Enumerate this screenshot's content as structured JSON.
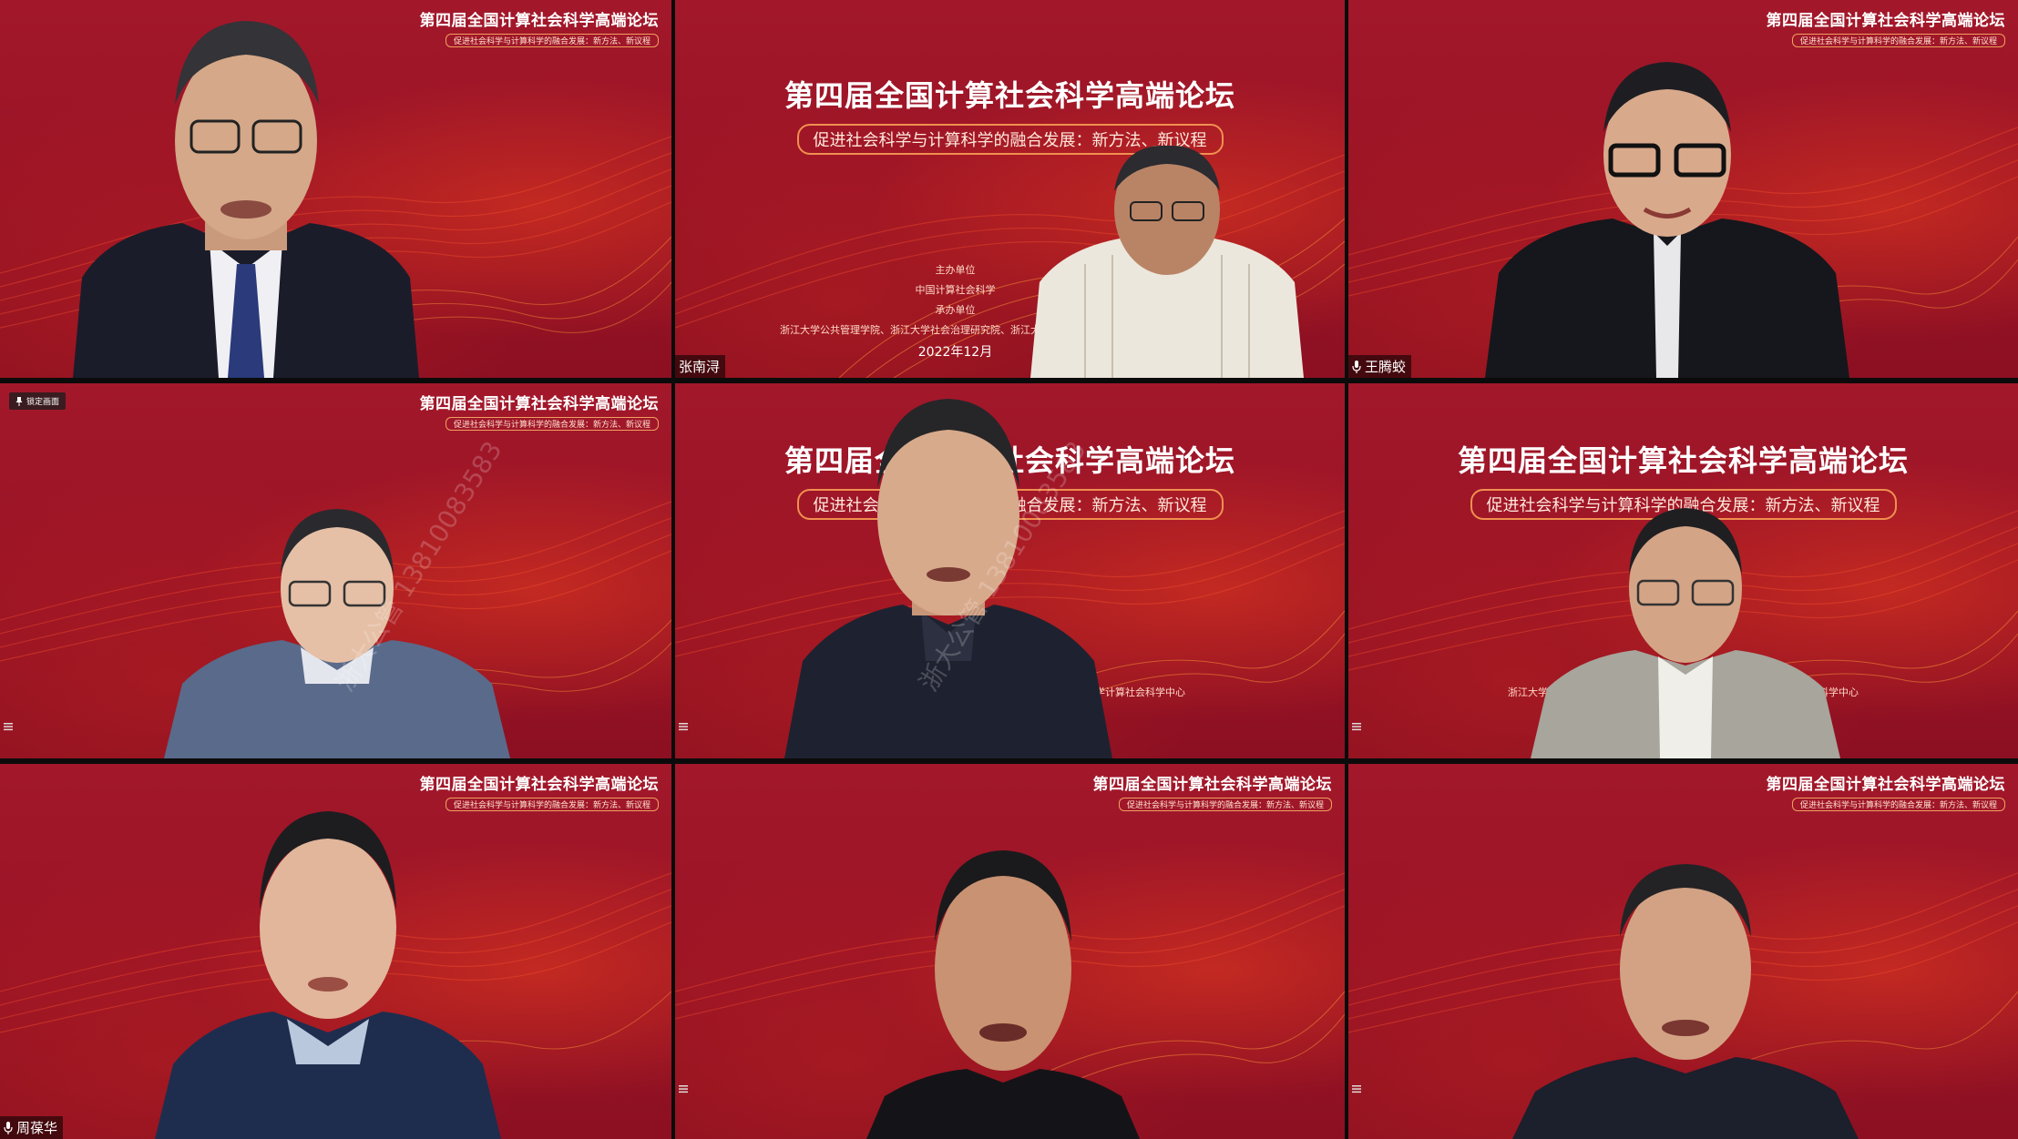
{
  "forum": {
    "title": "第四届全国计算社会科学高端论坛",
    "subtitle": "促进社会科学与计算科学的融合发展：新方法、新议程",
    "organizer_label": "主办单位",
    "organizer": "中国计算社会科学",
    "co_organizer_label": "承办单位",
    "co_organizer": "浙江大学公共管理学院、浙江大学社会治理研究院、浙江大学计算社会科学中心",
    "date": "2022年12月"
  },
  "tiles": [
    {
      "name": "",
      "layout": "small"
    },
    {
      "name": "张南浔",
      "layout": "large-info"
    },
    {
      "name": "王腾蛟",
      "layout": "small"
    },
    {
      "name": "",
      "layout": "small",
      "lock_button": "锁定画面"
    },
    {
      "name": "",
      "layout": "large"
    },
    {
      "name": "",
      "layout": "large"
    },
    {
      "name": "周葆华",
      "layout": "small"
    },
    {
      "name": "",
      "layout": "small"
    },
    {
      "name": "",
      "layout": "small"
    }
  ],
  "watermark": "浙大公管 13810083583",
  "colors": {
    "background_red": "#9c1427",
    "accent_orange": "#f07a36",
    "title_white": "#ffffff"
  }
}
